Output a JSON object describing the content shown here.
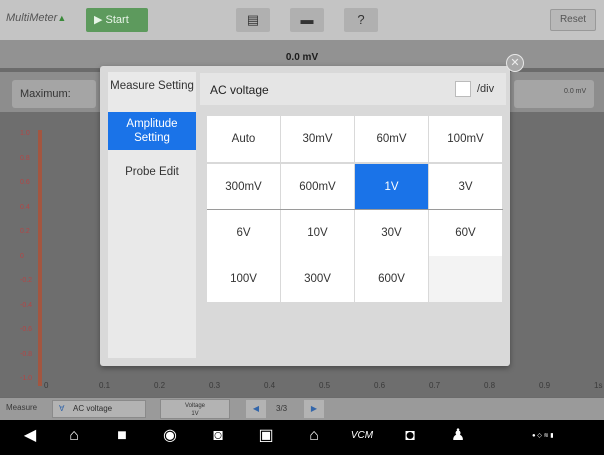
{
  "app": {
    "title": "MultiMeter",
    "start_label": "Start",
    "reset_label": "Reset",
    "reading": "0.0 mV"
  },
  "stats": {
    "maximum_label": "Maximum:",
    "right_value": "0.0 mV"
  },
  "plot": {
    "y_ticks": [
      "1.0",
      "0.8",
      "0.6",
      "0.4",
      "0.2",
      "0",
      "-0.2",
      "-0.4",
      "-0.6",
      "-0.8",
      "-1.0"
    ],
    "x_ticks": [
      "0",
      "0.1",
      "0.2",
      "0.3",
      "0.4",
      "0.5",
      "0.6",
      "0.7",
      "0.8",
      "0.9",
      "1s"
    ]
  },
  "bottom": {
    "measure_label": "Measure",
    "measure_value": "AC voltage",
    "voltage_label": "Voltage",
    "voltage_value": "1V",
    "page": "3/3"
  },
  "dialog": {
    "nav": [
      {
        "label": "Measure Setting"
      },
      {
        "label": "Amplitude Setting"
      },
      {
        "label": "Probe Edit"
      }
    ],
    "panel_title": "AC voltage",
    "div_label": "/div",
    "options": [
      "Auto",
      "30mV",
      "60mV",
      "100mV",
      "300mV",
      "600mV",
      "1V",
      "3V",
      "6V",
      "10V",
      "30V",
      "60V",
      "100V",
      "300V",
      "600V"
    ],
    "selected": "1V"
  },
  "colors": {
    "accent": "#1a73e8",
    "start_green": "#5d9a5d"
  }
}
